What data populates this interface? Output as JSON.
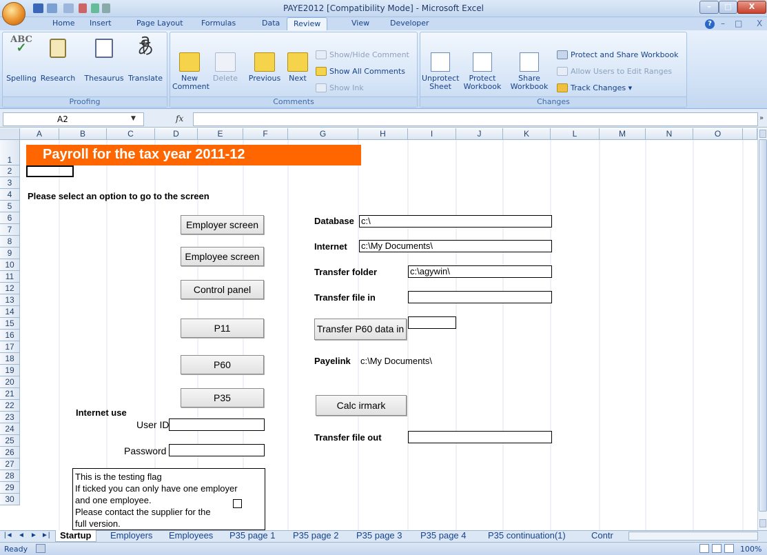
{
  "window": {
    "title": "PAYE2012  [Compatibility Mode] - Microsoft Excel",
    "minimize": "–",
    "maximize": "□",
    "close": "X"
  },
  "ribbon_tabs": [
    "Home",
    "Insert",
    "Page Layout",
    "Formulas",
    "Data",
    "Review",
    "View",
    "Developer"
  ],
  "active_tab": "Review",
  "groups": {
    "proofing": {
      "label": "Proofing",
      "buttons": [
        "Spelling",
        "Research",
        "Thesaurus",
        "Translate"
      ]
    },
    "comments": {
      "label": "Comments",
      "new_comment": [
        "New",
        "Comment"
      ],
      "delete": "Delete",
      "previous": "Previous",
      "next": "Next",
      "show_hide": "Show/Hide Comment",
      "show_all": "Show All Comments",
      "show_ink": "Show Ink"
    },
    "changes": {
      "label": "Changes",
      "unprotect": [
        "Unprotect",
        "Sheet"
      ],
      "protect": [
        "Protect",
        "Workbook"
      ],
      "share": [
        "Share",
        "Workbook"
      ],
      "protect_share": "Protect and Share Workbook",
      "allow_users": "Allow Users to Edit Ranges",
      "track": "Track Changes ▾"
    }
  },
  "formula_bar": {
    "name_box": "A2",
    "fx": "fx",
    "value": ""
  },
  "columns": [
    "A",
    "B",
    "C",
    "D",
    "E",
    "F",
    "G",
    "H",
    "I",
    "J",
    "K",
    "L",
    "M",
    "N",
    "O"
  ],
  "rows": [
    "1",
    "2",
    "3",
    "4",
    "5",
    "6",
    "7",
    "8",
    "9",
    "10",
    "11",
    "12",
    "13",
    "14",
    "15",
    "16",
    "17",
    "18",
    "19",
    "20",
    "21",
    "22",
    "23",
    "24",
    "25",
    "26",
    "27",
    "28",
    "29",
    "30"
  ],
  "sheet": {
    "title": "Payroll for the tax year 2011-12",
    "prompt": "Please select an option to go to the screen",
    "buttons": {
      "employer": "Employer screen",
      "employee": "Employee screen",
      "control": "Control panel",
      "p11": "P11",
      "p60": "P60",
      "p35": "P35",
      "transfer_p60": "Transfer P60 data in",
      "calc": "Calc irmark"
    },
    "internet_use": "Internet use",
    "user_id_label": "User ID",
    "user_id": "",
    "password_label": "Password",
    "password": "",
    "testing_text": [
      "This is the testing flag",
      "If ticked you can only have one employer",
      "and one employee.",
      "Please contact the supplier for the",
      "full version."
    ],
    "testing_checked": false,
    "database_label": "Database",
    "database": "c:\\",
    "internet_label": "Internet",
    "internet": "c:\\My Documents\\",
    "transfer_folder_label": "Transfer folder",
    "transfer_folder": "c:\\agywin\\",
    "transfer_in_label": "Transfer file in",
    "transfer_in": "",
    "transfer_p60_value": "",
    "payelink_label": "Payelink",
    "payelink": "c:\\My Documents\\",
    "transfer_out_label": "Transfer file out",
    "transfer_out": ""
  },
  "sheet_tabs": [
    "Startup",
    "Employers",
    "Employees",
    "P35 page 1",
    "P35 page 2",
    "P35 page 3",
    "P35 page 4",
    "P35 continuation(1)",
    "Contr"
  ],
  "active_sheet": "Startup",
  "status": {
    "text": "Ready",
    "zoom": "100%"
  },
  "colors": {
    "title_banner": "#ff6600",
    "ribbon": "#cfe0f5"
  }
}
